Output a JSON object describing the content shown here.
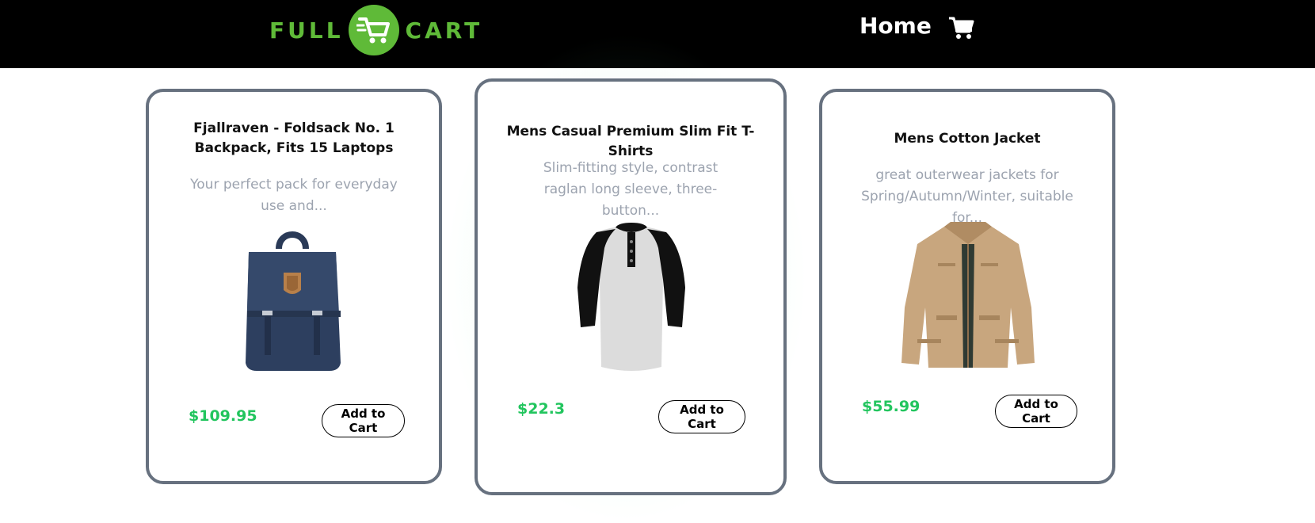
{
  "navbar": {
    "logo_left": "FULL",
    "logo_right": "CART",
    "home_label": "Home",
    "cart_icon": "shopping-cart-icon"
  },
  "colors": {
    "brand_green": "#5fba38",
    "price_green": "#22c55e",
    "card_border": "#67717f",
    "nav_bg": "#000000"
  },
  "products": [
    {
      "title": "Fjallraven - Foldsack No. 1 Backpack, Fits 15 Laptops",
      "description": "Your perfect pack for everyday use and...",
      "price": "$109.95",
      "button_label": "Add to Cart",
      "image": "backpack-image"
    },
    {
      "title": "Mens Casual Premium Slim Fit T-Shirts",
      "description": "Slim-fitting style, contrast raglan long sleeve, three-button...",
      "price": "$22.3",
      "button_label": "Add to Cart",
      "image": "tshirt-image"
    },
    {
      "title": "Mens Cotton Jacket",
      "description": "great outerwear jackets for Spring/Autumn/Winter, suitable for...",
      "price": "$55.99",
      "button_label": "Add to Cart",
      "image": "jacket-image"
    }
  ]
}
